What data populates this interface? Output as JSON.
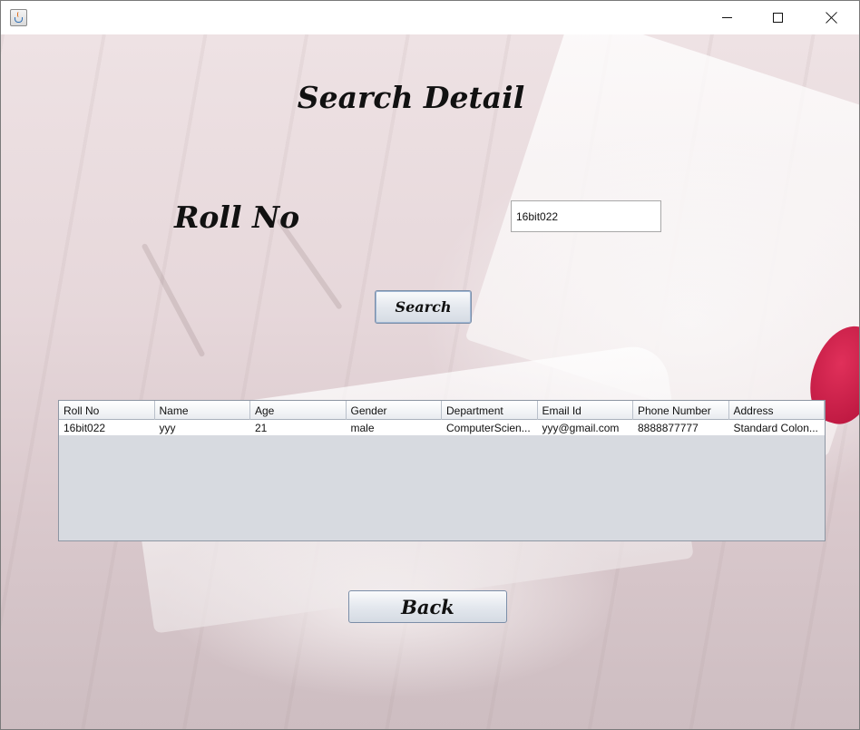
{
  "window": {
    "title": "",
    "icon": "java-cup-icon"
  },
  "page": {
    "heading": "Search Detail",
    "roll_label": "Roll No",
    "roll_value": "16bit022",
    "search_label": "Search",
    "back_label": "Back"
  },
  "table": {
    "columns": [
      "Roll No",
      "Name",
      "Age",
      "Gender",
      "Department",
      "Email Id",
      "Phone Number",
      "Address"
    ],
    "rows": [
      [
        "16bit022",
        "yyy",
        "21",
        "male",
        "ComputerScien...",
        "yyy@gmail.com",
        "8888877777",
        "Standard Colon..."
      ]
    ]
  },
  "colors": {
    "button_border": "#7b8ea8",
    "table_empty": "#d7dae0",
    "accent_petal": "#c81e48"
  }
}
